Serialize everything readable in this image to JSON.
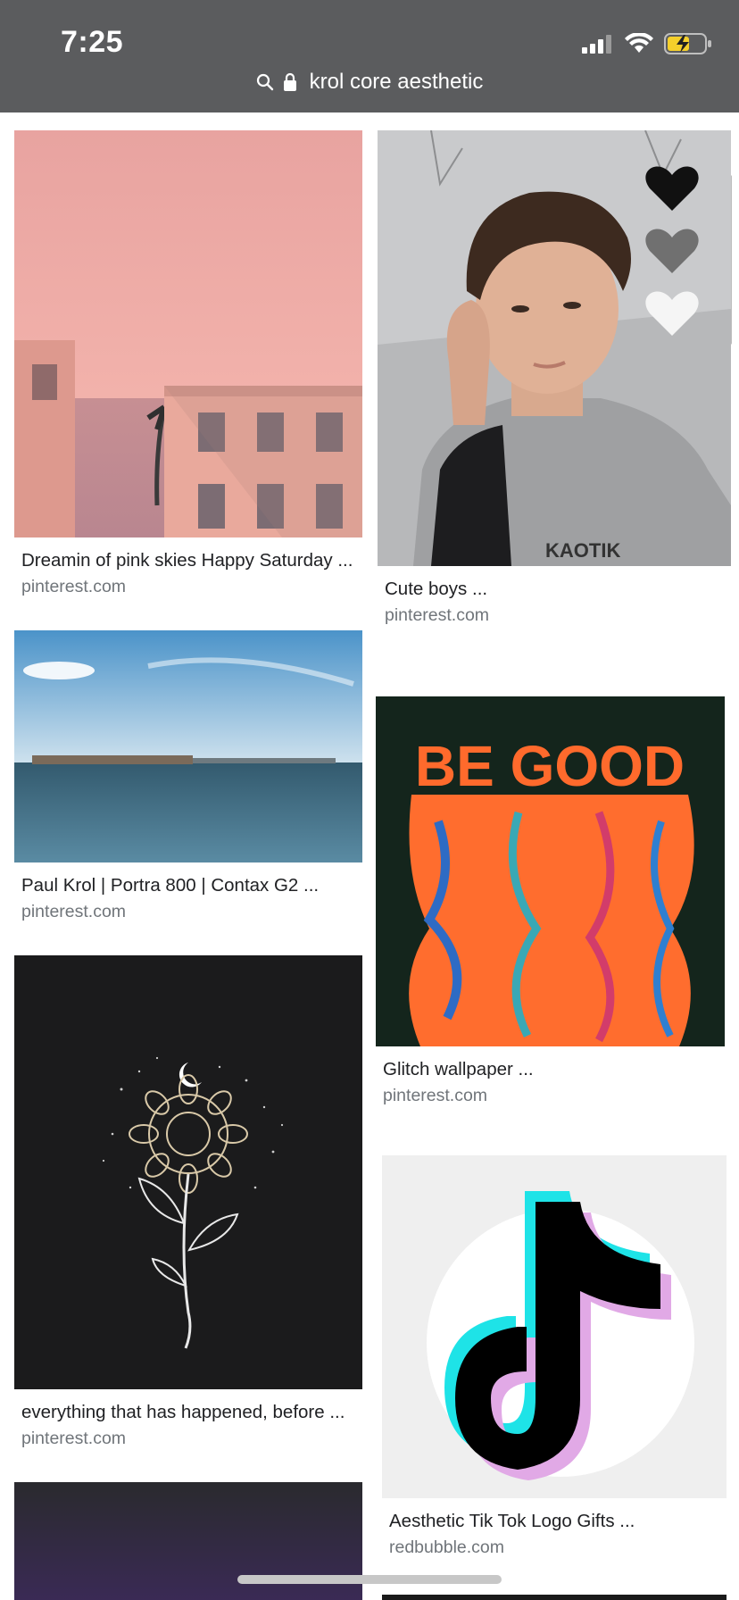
{
  "status_bar": {
    "time": "7:25",
    "signal_icon": "cellular-signal-icon",
    "wifi_icon": "wifi-icon",
    "battery_icon": "battery-charging-icon",
    "battery_color": "#f5cf2b"
  },
  "url_bar": {
    "search_icon": "search-icon",
    "lock_icon": "lock-icon",
    "text": "krol core aesthetic"
  },
  "results": [
    {
      "title": "Dreamin of pink skies Happy Saturday ...",
      "source": "pinterest.com"
    },
    {
      "title": "Cute boys ...",
      "source": "pinterest.com"
    },
    {
      "title": "Paul Krol | Portra 800 | Contax G2 ...",
      "source": "pinterest.com"
    },
    {
      "title": "Glitch wallpaper ...",
      "source": "pinterest.com"
    },
    {
      "title": "everything that has happened, before ...",
      "source": "pinterest.com"
    },
    {
      "title": "Aesthetic Tik Tok Logo Gifts ...",
      "source": "redbubble.com"
    }
  ],
  "image_texts": {
    "hoodie_text": "KAOTIK",
    "poster_text": "BE GOOD"
  },
  "colors": {
    "topbar": "#5b5c5e",
    "caption": "#202124",
    "source": "#70757a"
  }
}
